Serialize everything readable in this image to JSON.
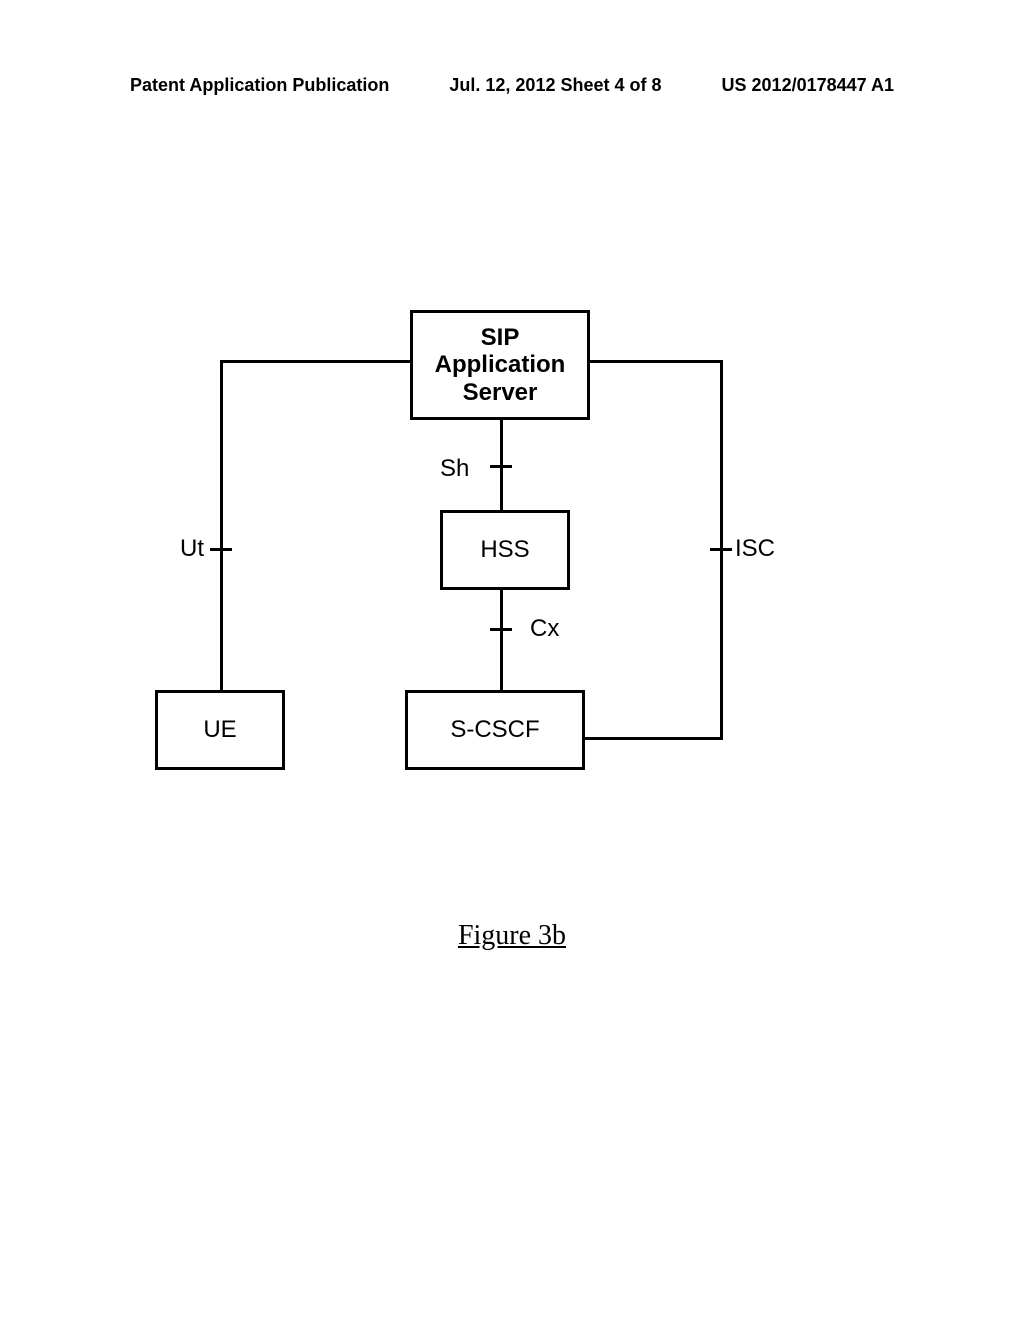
{
  "header": {
    "left": "Patent Application Publication",
    "center": "Jul. 12, 2012  Sheet 4 of 8",
    "right": "US 2012/0178447 A1"
  },
  "diagram": {
    "boxes": {
      "sip": "SIP\nApplication\nServer",
      "hss": "HSS",
      "scscf": "S-CSCF",
      "ue": "UE"
    },
    "interfaces": {
      "sh": "Sh",
      "ut": "Ut",
      "isc": "ISC",
      "cx": "Cx"
    }
  },
  "figure_caption": "Figure 3b"
}
